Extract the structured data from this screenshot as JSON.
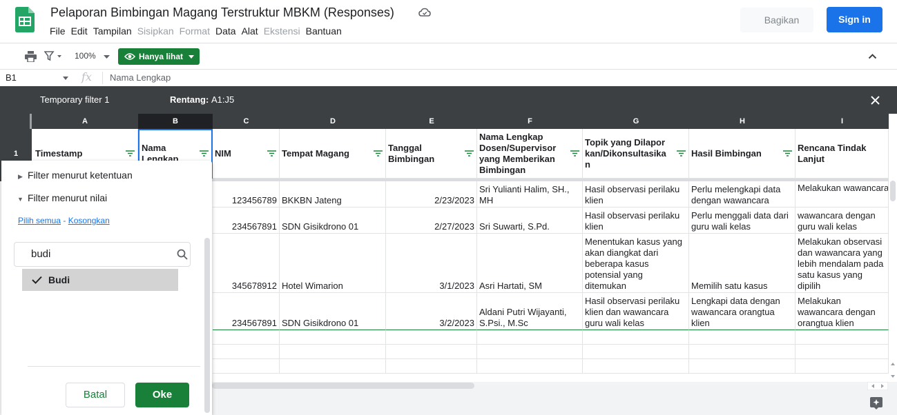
{
  "app": {
    "doc_title": "Pelaporan Bimbingan Magang Terstruktur MBKM (Responses)",
    "menu": [
      {
        "label": "File",
        "enabled": true
      },
      {
        "label": "Edit",
        "enabled": true
      },
      {
        "label": "Tampilan",
        "enabled": true
      },
      {
        "label": "Sisipkan",
        "enabled": false
      },
      {
        "label": "Format",
        "enabled": false
      },
      {
        "label": "Data",
        "enabled": true
      },
      {
        "label": "Alat",
        "enabled": true
      },
      {
        "label": "Ekstensi",
        "enabled": false
      },
      {
        "label": "Bantuan",
        "enabled": true
      }
    ],
    "share_label": "Bagikan",
    "signin_label": "Sign in",
    "brand_color": "#188038",
    "accent_color": "#1a73e8"
  },
  "toolbar": {
    "zoom": "100%",
    "view_only_label": "Hanya lihat"
  },
  "formula_bar": {
    "cell_ref": "B1",
    "fx": "fx",
    "content": "Nama Lengkap"
  },
  "filter_bar": {
    "name": "Temporary filter 1",
    "range_label": "Rentang:",
    "range_value": "A1:J5"
  },
  "grid": {
    "columns": [
      "A",
      "B",
      "C",
      "D",
      "E",
      "F",
      "G",
      "H",
      "I"
    ],
    "selected_column": "B",
    "row1_number": "1",
    "headers": {
      "a": "Timestamp",
      "b": "Nama Lengkap",
      "c": "NIM",
      "d": "Tempat Magang",
      "e": "Tanggal Bimbingan",
      "f": "Nama Lengkap Dosen/Supervisor yang Memberikan Bimbingan",
      "g": "Topik yang Dilaporkan/Dikonsultasikan",
      "h": "Hasil Bimbingan",
      "i": "Rencana Tindak Lanjut"
    },
    "rows": [
      {
        "nim": "123456789",
        "tempat": "BKKBN Jateng",
        "tanggal": "2/23/2023",
        "dosen": "Sri Yulianti Halim, SH., MH",
        "topik": "Hasil observasi perilaku klien",
        "hasil": "Perlu melengkapi data dengan wawancara",
        "rencana": "Melakukan wawancara dengan klien"
      },
      {
        "nim": "234567891",
        "tempat": "SDN Gisikdrono 01",
        "tanggal": "2/27/2023",
        "dosen": "Sri Suwarti, S.Pd.",
        "topik": "Hasil observasi perilaku klien",
        "hasil": "Perlu menggali data dari guru wali kelas",
        "rencana": "Melakukan wawancara dengan guru wali kelas"
      },
      {
        "nim": "345678912",
        "tempat": "Hotel Wimarion",
        "tanggal": "3/1/2023",
        "dosen": "Asri Hartati, SM",
        "topik": "Menentukan kasus yang akan diangkat dari beberapa kasus potensial yang ditemukan",
        "hasil": "Memilih satu kasus",
        "rencana": "Melakukan observasi dan wawancara yang lebih mendalam pada satu kasus yang dipilih"
      },
      {
        "nim": "234567891",
        "tempat": "SDN Gisikdrono 01",
        "tanggal": "3/2/2023",
        "dosen": "Aldani Putri Wijayanti, S.Psi., M.Sc",
        "topik": "Hasil observasi perilaku klien dan wawancara guru wali kelas",
        "hasil": "Lengkapi data dengan wawancara orangtua klien",
        "rencana": "Melakukan wawancara dengan orangtua klien"
      }
    ]
  },
  "filter_panel": {
    "by_condition": "Filter menurut ketentuan",
    "by_value": "Filter menurut nilai",
    "select_all": "Pilih semua",
    "separator": " - ",
    "clear": "Kosongkan",
    "search_value": "budi",
    "values": [
      {
        "label": "Budi",
        "checked": true
      }
    ],
    "cancel_label": "Batal",
    "ok_label": "Oke"
  }
}
